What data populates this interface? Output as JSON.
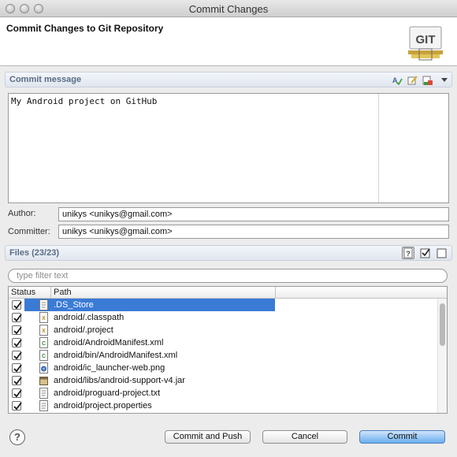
{
  "window": {
    "title": "Commit Changes"
  },
  "header": {
    "title": "Commit Changes to Git Repository",
    "logo_text": "GIT"
  },
  "commit_message": {
    "section_label": "Commit message",
    "text": "My Android project on GitHub"
  },
  "author": {
    "label": "Author:",
    "value": "unikys <unikys@gmail.com>"
  },
  "committer": {
    "label": "Committer:",
    "value": "unikys <unikys@gmail.com>"
  },
  "files": {
    "section_label": "Files (23/23)",
    "filter_placeholder": "type filter text",
    "columns": {
      "status": "Status",
      "path": "Path"
    },
    "rows": [
      {
        "path": ".DS_Store",
        "icon": "text-file-icon"
      },
      {
        "path": "android/.classpath",
        "icon": "xml-file-icon"
      },
      {
        "path": "android/.project",
        "icon": "xml-file-icon"
      },
      {
        "path": "android/AndroidManifest.xml",
        "icon": "xml-source-file-icon"
      },
      {
        "path": "android/bin/AndroidManifest.xml",
        "icon": "xml-source-file-icon"
      },
      {
        "path": "android/ic_launcher-web.png",
        "icon": "image-file-icon"
      },
      {
        "path": "android/libs/android-support-v4.jar",
        "icon": "jar-file-icon"
      },
      {
        "path": "android/proguard-project.txt",
        "icon": "text-file-icon"
      },
      {
        "path": "android/project.properties",
        "icon": "text-file-icon"
      }
    ]
  },
  "buttons": {
    "help": "?",
    "commit_and_push": "Commit and Push",
    "cancel": "Cancel",
    "commit": "Commit"
  },
  "colors": {
    "selection": "#3a7bd5",
    "section_label": "#596b86",
    "primary_button": "#6aaef0"
  }
}
